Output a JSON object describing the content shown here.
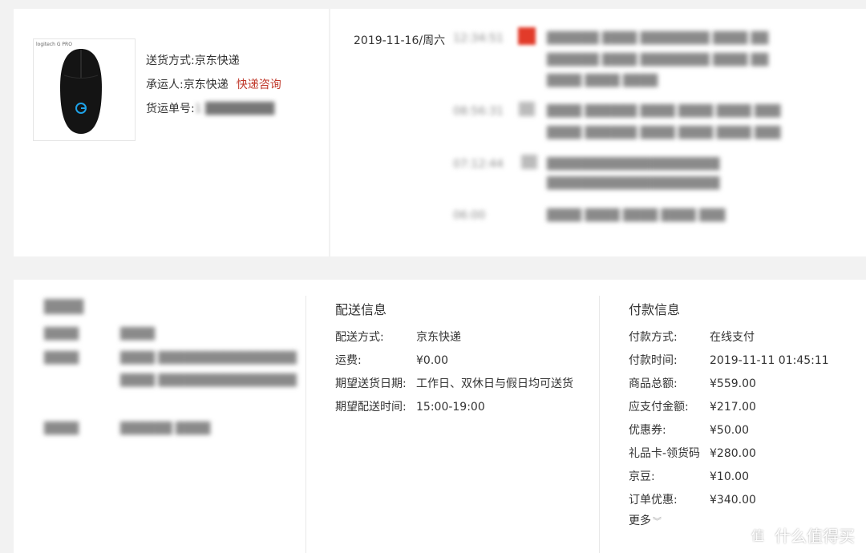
{
  "package": {
    "thumb_logo": "logitech G PRO",
    "delivery_method_label": "送货方式:",
    "delivery_method_value": "京东快递",
    "carrier_label": "承运人:",
    "carrier_value": "京东快递",
    "carrier_link": "快递咨询",
    "tracking_label": "货运单号:",
    "tracking_value": "1  ████████"
  },
  "tracking": {
    "date": "2019-11-16/周六",
    "blur_entries": [
      "12:34:51",
      "██████ ████ ████████ ████ ██",
      "████ ████ ████",
      "08:56:31",
      "████ ██████ ████ ████ ████ ███",
      "07:12:44",
      "████████████████████",
      "06:00",
      "████ ████ ████ ████ ███"
    ]
  },
  "recipient": {
    "title": "████",
    "rows": [
      {
        "k": "████",
        "v": "████"
      },
      {
        "k": "████",
        "v": "████ ████████████████"
      },
      {
        "k": "████",
        "v": "██████ ████"
      }
    ]
  },
  "delivery_info": {
    "title": "配送信息",
    "rows": [
      {
        "k": "配送方式:",
        "v": "京东快递"
      },
      {
        "k": "运费:",
        "v": "¥0.00"
      },
      {
        "k": "期望送货日期:",
        "v": "工作日、双休日与假日均可送货"
      },
      {
        "k": "期望配送时间:",
        "v": "15:00-19:00"
      }
    ]
  },
  "payment_info": {
    "title": "付款信息",
    "rows": [
      {
        "k": "付款方式:",
        "v": "在线支付"
      },
      {
        "k": "付款时间:",
        "v": "2019-11-11 01:45:11"
      },
      {
        "k": "商品总额:",
        "v": "¥559.00"
      },
      {
        "k": "应支付金额:",
        "v": "¥217.00"
      },
      {
        "k": "优惠券:",
        "v": "¥50.00"
      },
      {
        "k": "礼品卡-领货码",
        "v": "¥280.00"
      },
      {
        "k": "京豆:",
        "v": "¥10.00"
      },
      {
        "k": "订单优惠:",
        "v": "¥340.00"
      }
    ],
    "more_label": "更多"
  },
  "watermark": {
    "icon": "值",
    "text": "什么值得买"
  }
}
